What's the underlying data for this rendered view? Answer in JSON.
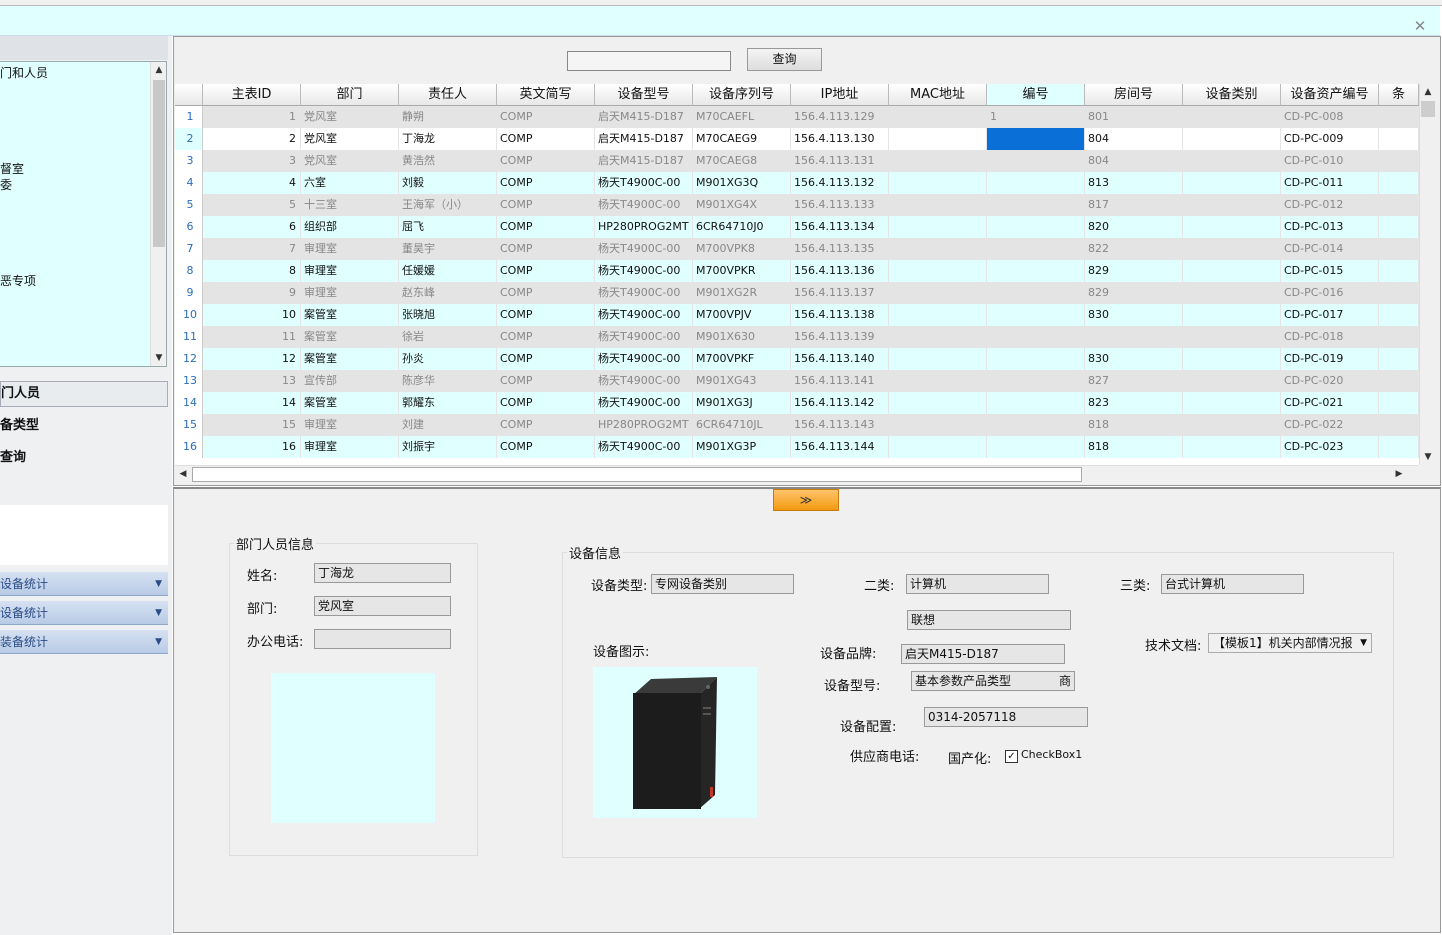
{
  "window": {
    "close": "✕"
  },
  "tree": {
    "items": [
      "门和人员",
      "督室",
      "委",
      "恶专项"
    ],
    "up": "▲",
    "down": "▼"
  },
  "nav": {
    "item1": "门人员",
    "item2": "备类型",
    "item3": "查询"
  },
  "stats": [
    {
      "label": "设备统计"
    },
    {
      "label": "设备统计"
    },
    {
      "label": "装备统计"
    }
  ],
  "search": {
    "value": "",
    "button": "查询"
  },
  "grid": {
    "columns": [
      "主表ID",
      "部门",
      "责任人",
      "英文简写",
      "设备型号",
      "设备序列号",
      "IP地址",
      "MAC地址",
      "编号",
      "房间号",
      "设备类别",
      "设备资产编号",
      "条"
    ],
    "rows": [
      {
        "n": "1",
        "id": "1",
        "dept": "党风室",
        "person": "静朔",
        "en": "COMP",
        "model": "启天M415-D187",
        "serial": "M70CAEFL",
        "ip": "156.4.113.129",
        "mac": "",
        "no": "1",
        "room": "801",
        "cat": "",
        "asset": "CD-PC-008"
      },
      {
        "n": "2",
        "id": "2",
        "dept": "党风室",
        "person": "丁海龙",
        "en": "COMP",
        "model": "启天M415-D187",
        "serial": "M70CAEG9",
        "ip": "156.4.113.130",
        "mac": "",
        "no": "",
        "room": "804",
        "cat": "",
        "asset": "CD-PC-009"
      },
      {
        "n": "3",
        "id": "3",
        "dept": "党风室",
        "person": "黄浩然",
        "en": "COMP",
        "model": "启天M415-D187",
        "serial": "M70CAEG8",
        "ip": "156.4.113.131",
        "mac": "",
        "no": "",
        "room": "804",
        "cat": "",
        "asset": "CD-PC-010"
      },
      {
        "n": "4",
        "id": "4",
        "dept": "六室",
        "person": "刘毅",
        "en": "COMP",
        "model": "杨天T4900C-00",
        "serial": "M901XG3Q",
        "ip": "156.4.113.132",
        "mac": "",
        "no": "",
        "room": "813",
        "cat": "",
        "asset": "CD-PC-011"
      },
      {
        "n": "5",
        "id": "5",
        "dept": "十三室",
        "person": "王海军（小）",
        "en": "COMP",
        "model": "杨天T4900C-00",
        "serial": "M901XG4X",
        "ip": "156.4.113.133",
        "mac": "",
        "no": "",
        "room": "817",
        "cat": "",
        "asset": "CD-PC-012"
      },
      {
        "n": "6",
        "id": "6",
        "dept": "组织部",
        "person": "屈飞",
        "en": "COMP",
        "model": "HP280PROG2MT",
        "serial": "6CR64710J0",
        "ip": "156.4.113.134",
        "mac": "",
        "no": "",
        "room": "820",
        "cat": "",
        "asset": "CD-PC-013"
      },
      {
        "n": "7",
        "id": "7",
        "dept": "审理室",
        "person": "董昊宇",
        "en": "COMP",
        "model": "杨天T4900C-00",
        "serial": "M700VPK8",
        "ip": "156.4.113.135",
        "mac": "",
        "no": "",
        "room": "822",
        "cat": "",
        "asset": "CD-PC-014"
      },
      {
        "n": "8",
        "id": "8",
        "dept": "审理室",
        "person": "任媛媛",
        "en": "COMP",
        "model": "杨天T4900C-00",
        "serial": "M700VPKR",
        "ip": "156.4.113.136",
        "mac": "",
        "no": "",
        "room": "829",
        "cat": "",
        "asset": "CD-PC-015"
      },
      {
        "n": "9",
        "id": "9",
        "dept": "审理室",
        "person": "赵东峰",
        "en": "COMP",
        "model": "杨天T4900C-00",
        "serial": "M901XG2R",
        "ip": "156.4.113.137",
        "mac": "",
        "no": "",
        "room": "829",
        "cat": "",
        "asset": "CD-PC-016"
      },
      {
        "n": "10",
        "id": "10",
        "dept": "案管室",
        "person": "张晓旭",
        "en": "COMP",
        "model": "杨天T4900C-00",
        "serial": "M700VPJV",
        "ip": "156.4.113.138",
        "mac": "",
        "no": "",
        "room": "830",
        "cat": "",
        "asset": "CD-PC-017"
      },
      {
        "n": "11",
        "id": "11",
        "dept": "案管室",
        "person": "徐岩",
        "en": "COMP",
        "model": "杨天T4900C-00",
        "serial": "M901X630",
        "ip": "156.4.113.139",
        "mac": "",
        "no": "",
        "room": "",
        "cat": "",
        "asset": "CD-PC-018"
      },
      {
        "n": "12",
        "id": "12",
        "dept": "案管室",
        "person": "孙炎",
        "en": "COMP",
        "model": "杨天T4900C-00",
        "serial": "M700VPKF",
        "ip": "156.4.113.140",
        "mac": "",
        "no": "",
        "room": "830",
        "cat": "",
        "asset": "CD-PC-019"
      },
      {
        "n": "13",
        "id": "13",
        "dept": "宣传部",
        "person": "陈彦华",
        "en": "COMP",
        "model": "杨天T4900C-00",
        "serial": "M901XG43",
        "ip": "156.4.113.141",
        "mac": "",
        "no": "",
        "room": "827",
        "cat": "",
        "asset": "CD-PC-020"
      },
      {
        "n": "14",
        "id": "14",
        "dept": "案管室",
        "person": "郭耀东",
        "en": "COMP",
        "model": "杨天T4900C-00",
        "serial": "M901XG3J",
        "ip": "156.4.113.142",
        "mac": "",
        "no": "",
        "room": "823",
        "cat": "",
        "asset": "CD-PC-021"
      },
      {
        "n": "15",
        "id": "15",
        "dept": "审理室",
        "person": "刘建",
        "en": "COMP",
        "model": "HP280PROG2MT",
        "serial": "6CR64710JL",
        "ip": "156.4.113.143",
        "mac": "",
        "no": "",
        "room": "818",
        "cat": "",
        "asset": "CD-PC-022"
      },
      {
        "n": "16",
        "id": "16",
        "dept": "审理室",
        "person": "刘振宇",
        "en": "COMP",
        "model": "杨天T4900C-00",
        "serial": "M901XG3P",
        "ip": "156.4.113.144",
        "mac": "",
        "no": "",
        "room": "818",
        "cat": "",
        "asset": "CD-PC-023"
      }
    ]
  },
  "collapse": "≫",
  "person": {
    "title": "部门人员信息",
    "name_label": "姓名:",
    "name": "丁海龙",
    "dept_label": "部门:",
    "dept": "党风室",
    "phone_label": "办公电话:",
    "phone": ""
  },
  "device": {
    "title": "设备信息",
    "type_label": "设备类型:",
    "type": "专网设备类别",
    "class2_label": "二类:",
    "class2": "计算机",
    "class3_label": "三类:",
    "class3": "台式计算机",
    "vendor_box": "联想",
    "image_label": "设备图示:",
    "brand_label": "设备品牌:",
    "brand": "启天M415-D187",
    "model_label": "设备型号:",
    "model": "基本参数产品类型",
    "model_suffix": "商",
    "config_label": "设备配置:",
    "config": "0314-2057118",
    "supplier_label": "供应商电话:",
    "domestic_label": "国产化:",
    "checkbox_label": "CheckBox1",
    "doc_label": "技术文档:",
    "doc": "【模板1】机关内部情况报"
  },
  "colors": {
    "accent": "#e0ffff",
    "button_orange": "#f29a10",
    "selected_cell": "#0a6fd6"
  }
}
